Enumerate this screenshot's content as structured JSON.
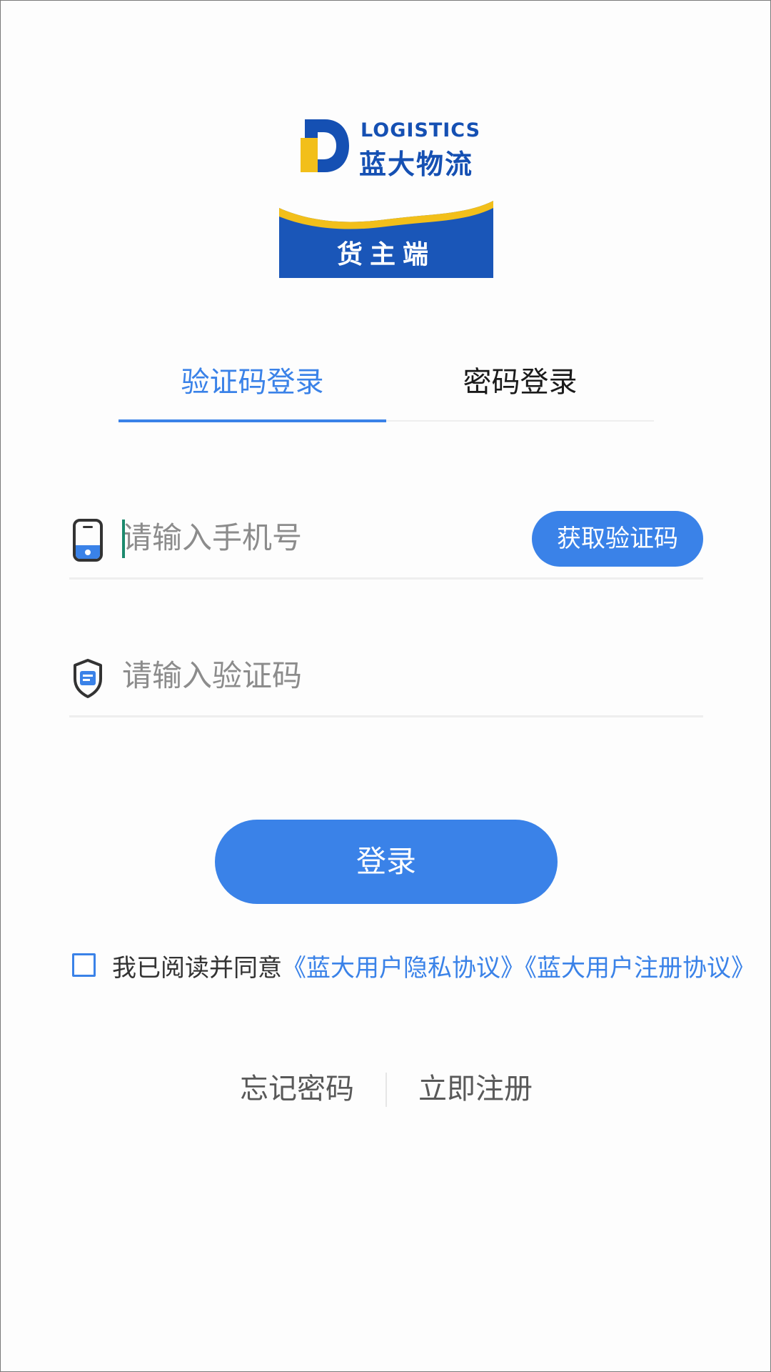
{
  "brand": {
    "logo_en": "LOGISTICS",
    "logo_cn": "蓝大物流",
    "banner_text": "货主端",
    "colors": {
      "brand_blue": "#1550b3",
      "brand_yellow": "#f2bf1a"
    }
  },
  "tabs": [
    {
      "label": "验证码登录",
      "active": true
    },
    {
      "label": "密码登录",
      "active": false
    }
  ],
  "form": {
    "phone": {
      "placeholder": "请输入手机号",
      "value": "",
      "icon": "phone-icon"
    },
    "get_code_label": "获取验证码",
    "code": {
      "placeholder": "请输入验证码",
      "value": "",
      "icon": "shield-verify-icon"
    },
    "login_label": "登录"
  },
  "agreement": {
    "checked": false,
    "prefix": "我已阅读并同意",
    "privacy_link": "《蓝大用户隐私协议》",
    "register_link": "《蓝大用户注册协议》"
  },
  "links": {
    "forgot": "忘记密码",
    "register": "立即注册"
  },
  "colors": {
    "accent": "#3a82e8",
    "placeholder": "#8c8c8c",
    "divider": "#eeeeee"
  }
}
